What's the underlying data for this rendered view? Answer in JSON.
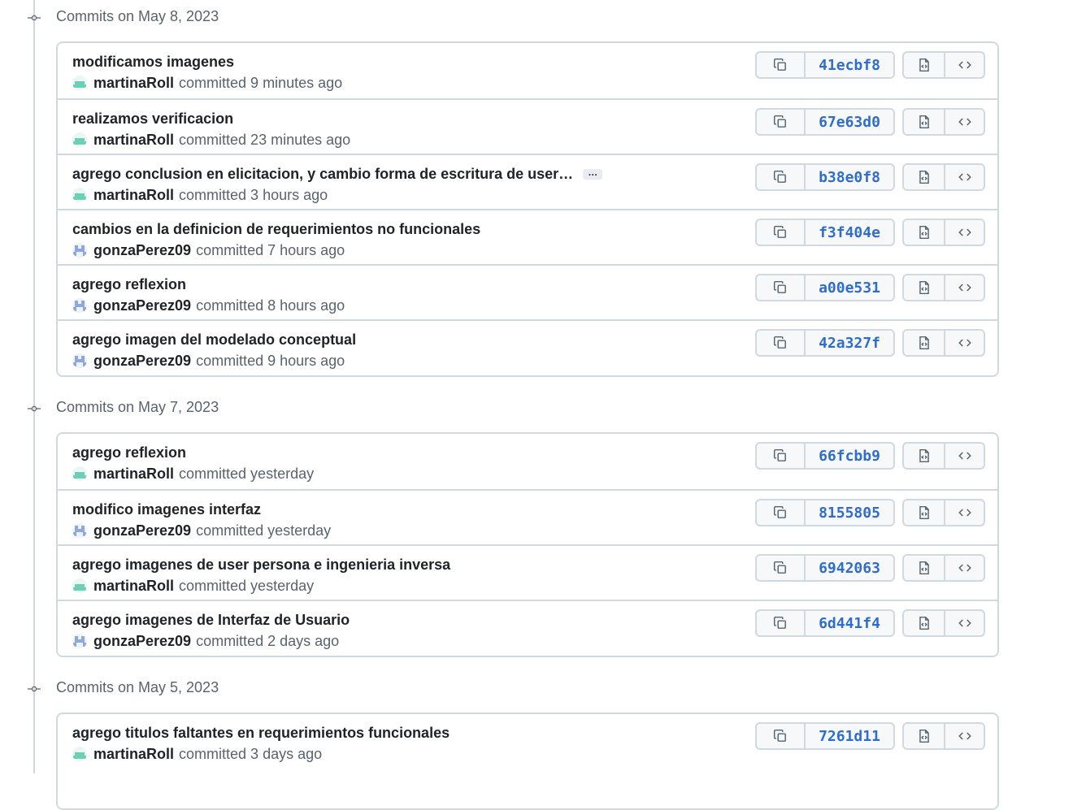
{
  "groups": [
    {
      "title": "Commits on May 8, 2023",
      "commits": [
        {
          "message": "modificamos imagenes",
          "author": "martinaRoll",
          "when": "committed 9 minutes ago",
          "sha": "41ecbf8",
          "avatar": "teal"
        },
        {
          "message": "realizamos verificacion",
          "author": "martinaRoll",
          "when": "committed 23 minutes ago",
          "sha": "67e63d0",
          "avatar": "teal"
        },
        {
          "message": "agrego conclusion en elicitacion, y cambio forma de escritura de user…",
          "author": "martinaRoll",
          "when": "committed 3 hours ago",
          "sha": "b38e0f8",
          "avatar": "teal",
          "ellipsis": "…"
        },
        {
          "message": "cambios en la definicion de requerimientos no funcionales",
          "author": "gonzaPerez09",
          "when": "committed 7 hours ago",
          "sha": "f3f404e",
          "avatar": "blue"
        },
        {
          "message": "agrego reflexion",
          "author": "gonzaPerez09",
          "when": "committed 8 hours ago",
          "sha": "a00e531",
          "avatar": "blue"
        },
        {
          "message": "agrego imagen del modelado conceptual",
          "author": "gonzaPerez09",
          "when": "committed 9 hours ago",
          "sha": "42a327f",
          "avatar": "blue"
        }
      ]
    },
    {
      "title": "Commits on May 7, 2023",
      "commits": [
        {
          "message": "agrego reflexion",
          "author": "martinaRoll",
          "when": "committed yesterday",
          "sha": "66fcbb9",
          "avatar": "teal"
        },
        {
          "message": "modifico imagenes interfaz",
          "author": "gonzaPerez09",
          "when": "committed yesterday",
          "sha": "8155805",
          "avatar": "blue"
        },
        {
          "message": "agrego imagenes de user persona e ingenieria inversa",
          "author": "martinaRoll",
          "when": "committed yesterday",
          "sha": "6942063",
          "avatar": "teal"
        },
        {
          "message": "agrego imagenes de Interfaz de Usuario",
          "author": "gonzaPerez09",
          "when": "committed 2 days ago",
          "sha": "6d441f4",
          "avatar": "blue"
        }
      ]
    },
    {
      "title": "Commits on May 5, 2023",
      "commits": [
        {
          "message": "agrego titulos faltantes en requerimientos funcionales",
          "author": "martinaRoll",
          "when": "committed 3 days ago",
          "sha": "7261d11",
          "avatar": "teal"
        }
      ]
    }
  ],
  "icons": {
    "copy": "copy-icon",
    "browse_files": "file-code-icon",
    "browse_repo": "code-icon",
    "timeline_node": "git-commit-icon"
  },
  "colors": {
    "sha_link": "#2f6dcc",
    "avatar_teal": "#6ccfb7",
    "avatar_blue": "#8ea8dc",
    "border": "#d1d9e0"
  }
}
